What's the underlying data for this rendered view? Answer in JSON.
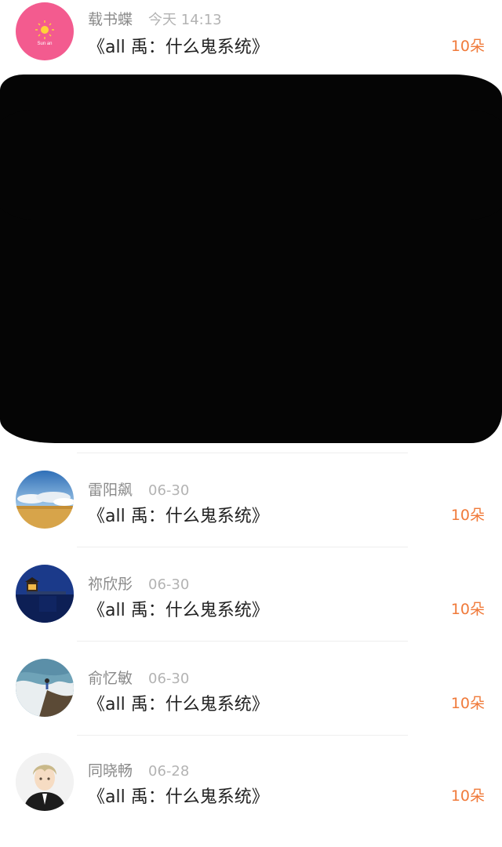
{
  "colors": {
    "accent": "#f07a3a",
    "name_text": "#8a8a8a",
    "time_text": "#b3b3b3",
    "title_text": "#222222",
    "divider": "#eeeeee",
    "redaction": "#050505"
  },
  "items": [
    {
      "name": "载书蝶",
      "time": "今天 14:13",
      "title": "《all 禹：什么鬼系统》",
      "amount": "10朵",
      "avatar": {
        "type": "pink-sun",
        "text": "Sun an"
      }
    },
    {
      "name": "雷阳飙",
      "time": "06-30",
      "title": "《all 禹：什么鬼系统》",
      "amount": "10朵",
      "avatar": {
        "type": "sky-field"
      }
    },
    {
      "name": "祢欣彤",
      "time": "06-30",
      "title": "《all 禹：什么鬼系统》",
      "amount": "10朵",
      "avatar": {
        "type": "night-pier"
      }
    },
    {
      "name": "俞忆敏",
      "time": "06-30",
      "title": "《all 禹：什么鬼系统》",
      "amount": "10朵",
      "avatar": {
        "type": "beach-waves"
      }
    },
    {
      "name": "同晓畅",
      "time": "06-28",
      "title": "《all 禹：什么鬼系统》",
      "amount": "10朵",
      "avatar": {
        "type": "anime-boy"
      }
    }
  ],
  "redacted_region": {
    "visible": true,
    "description": "blacked-out list rows"
  }
}
